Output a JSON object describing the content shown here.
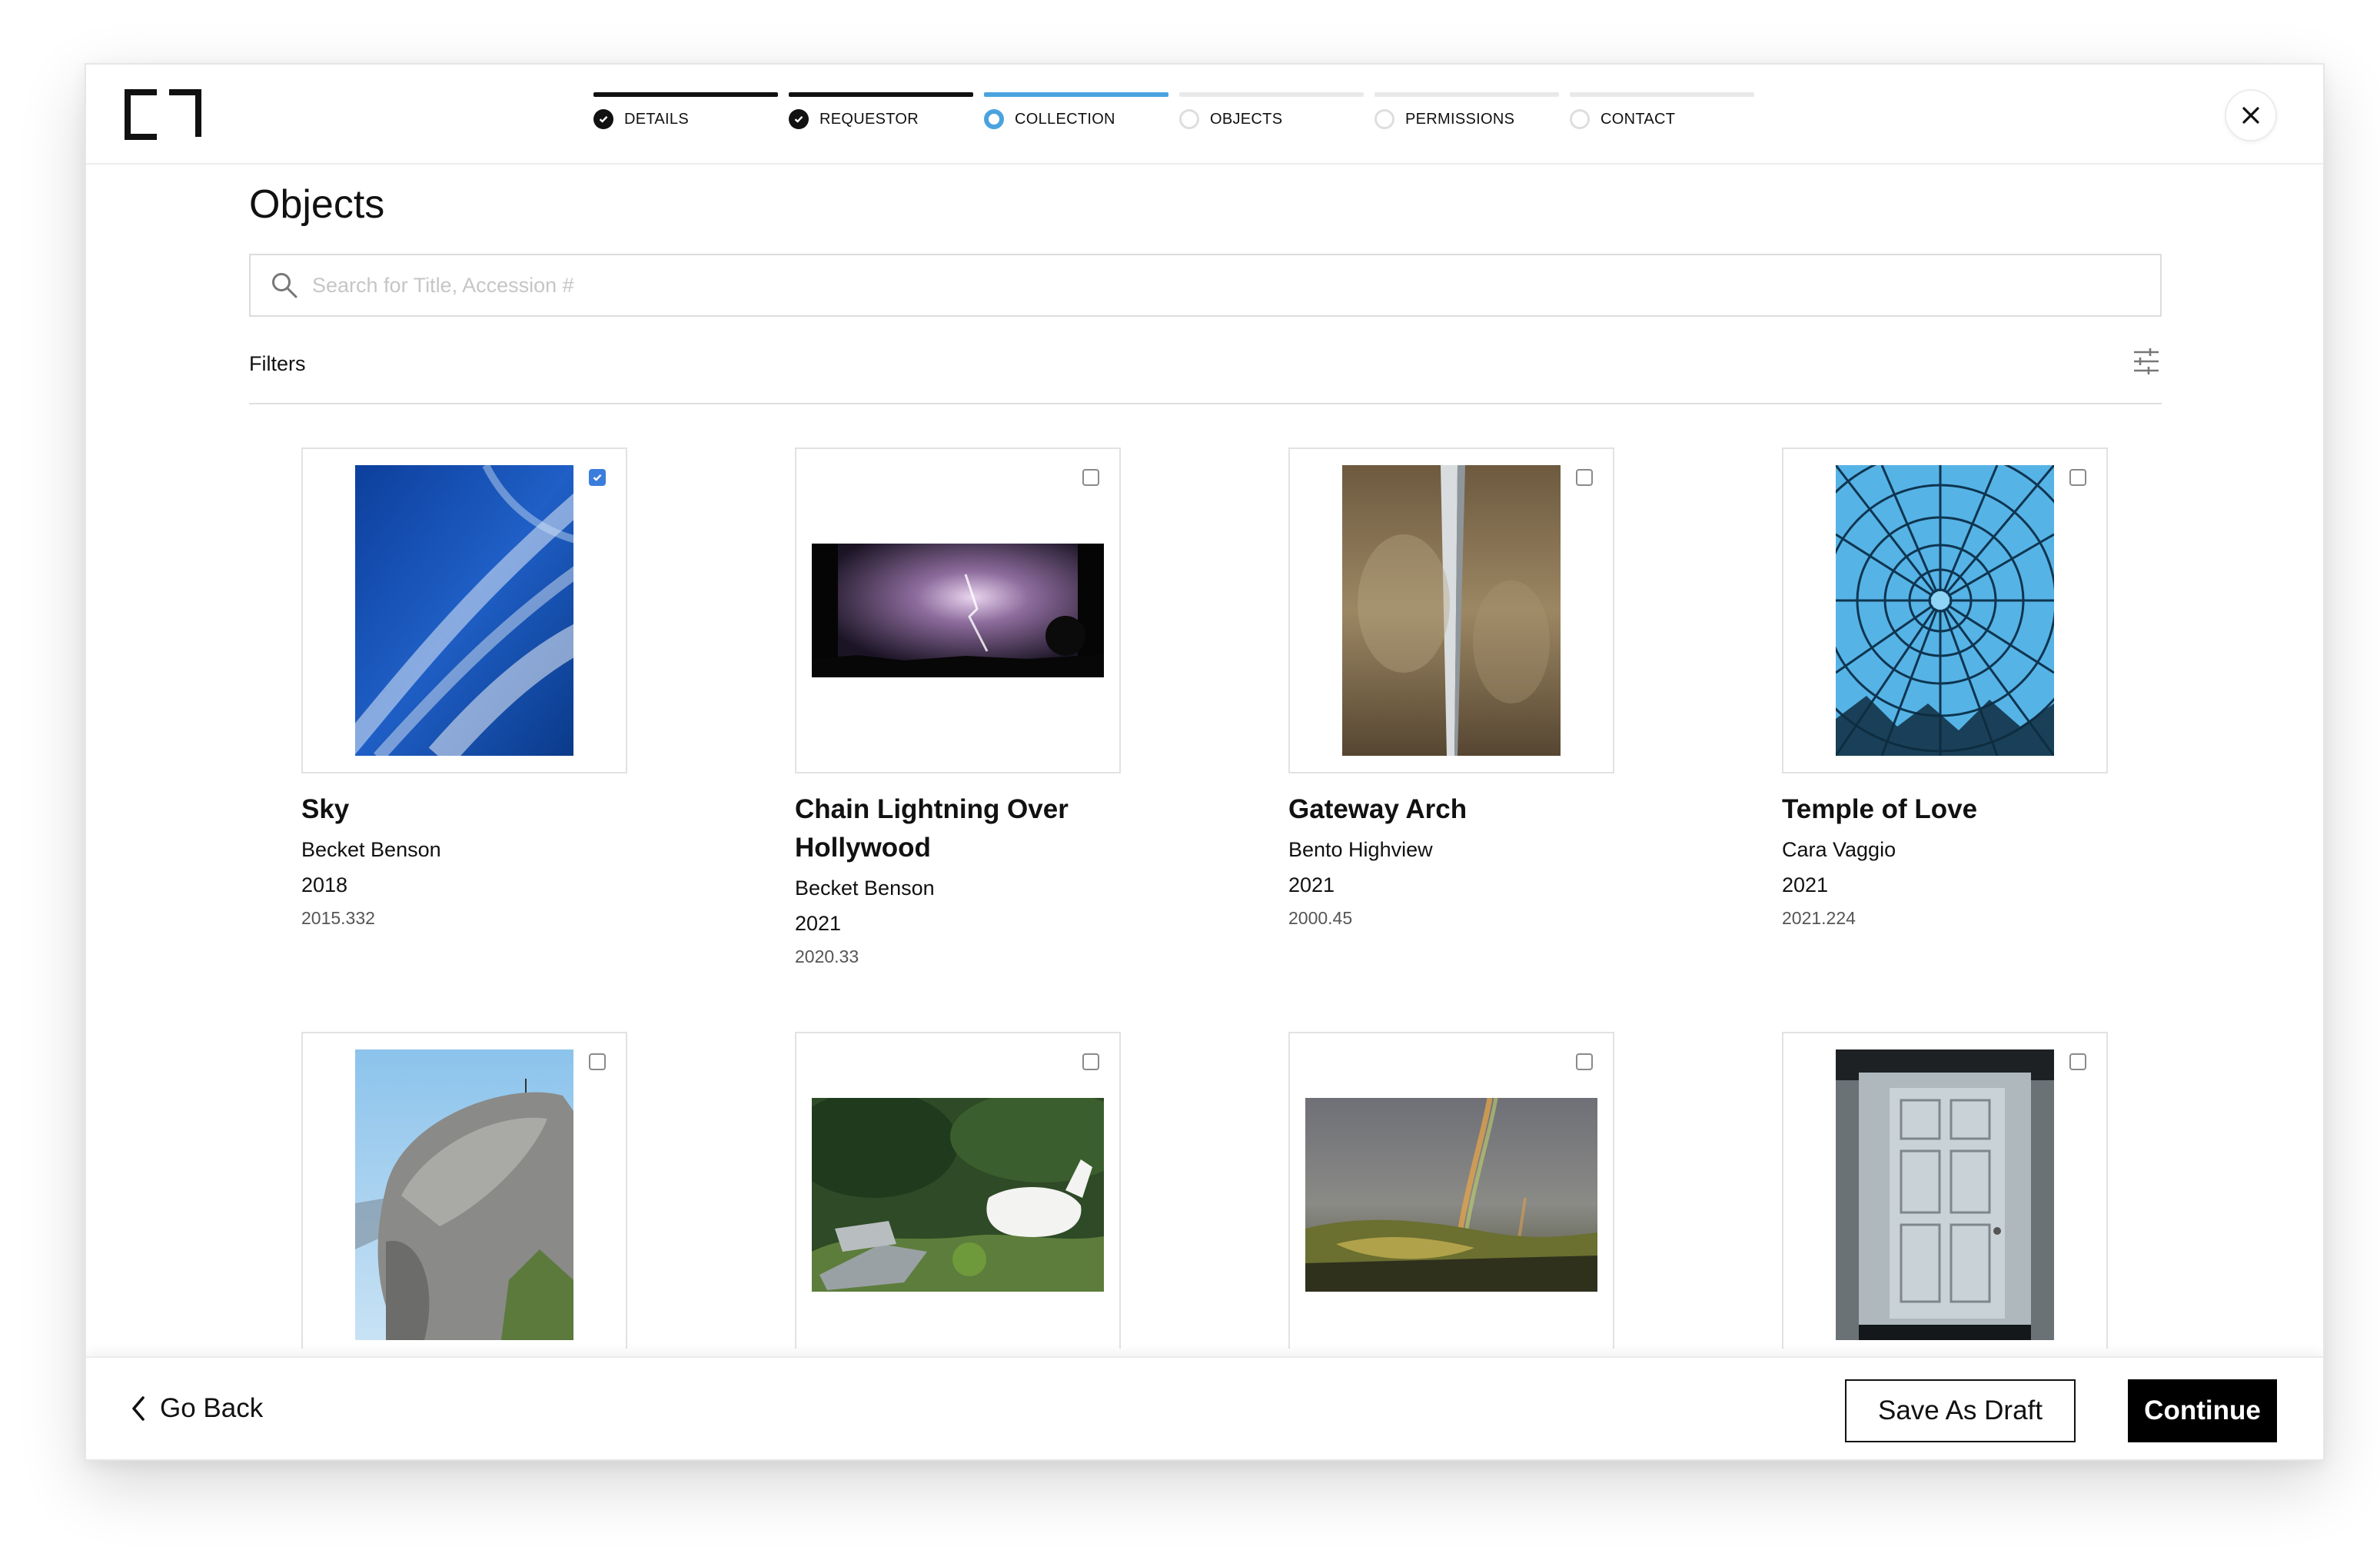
{
  "steps": [
    {
      "label": "Details",
      "state": "done"
    },
    {
      "label": "Requestor",
      "state": "done"
    },
    {
      "label": "Collection",
      "state": "current"
    },
    {
      "label": "Objects",
      "state": "todo"
    },
    {
      "label": "Permissions",
      "state": "todo"
    },
    {
      "label": "Contact",
      "state": "todo"
    }
  ],
  "page": {
    "title": "Objects"
  },
  "search": {
    "placeholder": "Search for Title, Accession #",
    "value": ""
  },
  "filters": {
    "label": "Filters"
  },
  "objects": [
    {
      "title": "Sky",
      "artist": "Becket Benson",
      "year": "2018",
      "accession": "2015.332",
      "selected": true
    },
    {
      "title": "Chain Lightning Over Hollywood",
      "artist": "Becket Benson",
      "year": "2021",
      "accession": "2020.33",
      "selected": false
    },
    {
      "title": "Gateway Arch",
      "artist": "Bento Highview",
      "year": "2021",
      "accession": "2000.45",
      "selected": false
    },
    {
      "title": "Temple of Love",
      "artist": "Cara Vaggio",
      "year": "2021",
      "accession": "2021.224",
      "selected": false
    },
    {
      "title": "",
      "artist": "",
      "year": "",
      "accession": "",
      "selected": false
    },
    {
      "title": "",
      "artist": "",
      "year": "",
      "accession": "",
      "selected": false
    },
    {
      "title": "",
      "artist": "",
      "year": "",
      "accession": "",
      "selected": false
    },
    {
      "title": "",
      "artist": "",
      "year": "",
      "accession": "",
      "selected": false
    }
  ],
  "footer": {
    "back_label": "Go Back",
    "draft_label": "Save As Draft",
    "continue_label": "Continue"
  },
  "colors": {
    "accent": "#4aa3df",
    "checkbox_selected": "#3b7ddd",
    "primary": "#000000"
  },
  "icons": {
    "logo": "brand-logo",
    "step_done": "check-circle-icon",
    "step_current": "ring-icon",
    "step_todo": "empty-circle-icon",
    "close": "close-icon",
    "search": "search-icon",
    "filters": "sliders-icon",
    "back": "chevron-left-icon"
  }
}
